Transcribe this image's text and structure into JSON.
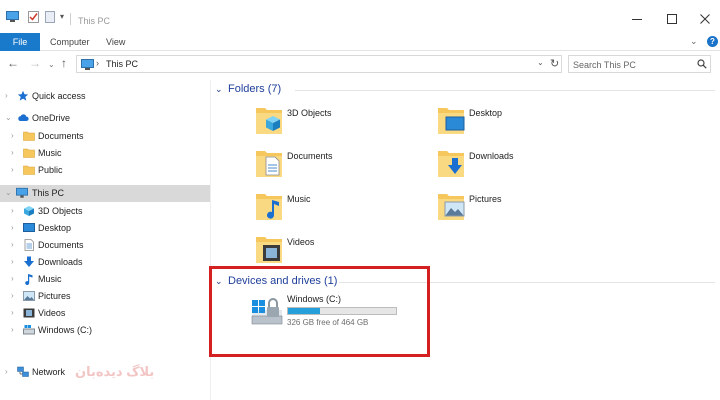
{
  "window": {
    "title": "This PC",
    "controls": [
      "minimize-icon",
      "maximize-icon",
      "close-icon"
    ]
  },
  "ribbon": {
    "tabs": [
      {
        "label": "File",
        "active": true
      },
      {
        "label": "Computer"
      },
      {
        "label": "View"
      }
    ],
    "help_glyph": "?"
  },
  "address": {
    "path": "This PC",
    "search_placeholder": "Search This PC"
  },
  "nav": {
    "items": [
      {
        "label": "Quick access",
        "icon": "star-icon"
      },
      {
        "label": "OneDrive",
        "icon": "cloud-icon"
      },
      {
        "label": "Documents",
        "icon": "folder-icon"
      },
      {
        "label": "Music",
        "icon": "folder-icon"
      },
      {
        "label": "Public",
        "icon": "folder-icon"
      },
      {
        "label": "This PC",
        "icon": "computer-icon",
        "selected": true
      },
      {
        "label": "3D Objects",
        "icon": "cube-icon"
      },
      {
        "label": "Desktop",
        "icon": "desktop-icon"
      },
      {
        "label": "Documents",
        "icon": "document-icon"
      },
      {
        "label": "Downloads",
        "icon": "download-icon"
      },
      {
        "label": "Music",
        "icon": "music-note-icon"
      },
      {
        "label": "Pictures",
        "icon": "picture-icon"
      },
      {
        "label": "Videos",
        "icon": "film-icon"
      },
      {
        "label": "Windows (C:)",
        "icon": "drive-icon"
      },
      {
        "label": "Network",
        "icon": "network-icon"
      }
    ]
  },
  "content": {
    "folders_group": "Folders (7)",
    "folders": [
      {
        "label": "3D Objects",
        "icon": "cube-icon"
      },
      {
        "label": "Desktop",
        "icon": "desktop-icon"
      },
      {
        "label": "Documents",
        "icon": "document-icon"
      },
      {
        "label": "Downloads",
        "icon": "download-icon"
      },
      {
        "label": "Music",
        "icon": "music-note-icon"
      },
      {
        "label": "Pictures",
        "icon": "picture-icon"
      },
      {
        "label": "Videos",
        "icon": "film-icon"
      }
    ],
    "devices_group": "Devices and drives (1)",
    "drive": {
      "label": "Windows (C:)",
      "free_text": "326 GB free of 464 GB",
      "used_fraction": 0.297
    }
  },
  "watermark": "بلاگ دیده‌بان",
  "colors": {
    "accent": "#1979ca",
    "highlight": "#d42020",
    "folder": "#f6c75d",
    "selected_bg": "#d9d9d9",
    "drive_fill": "#26a0da"
  }
}
